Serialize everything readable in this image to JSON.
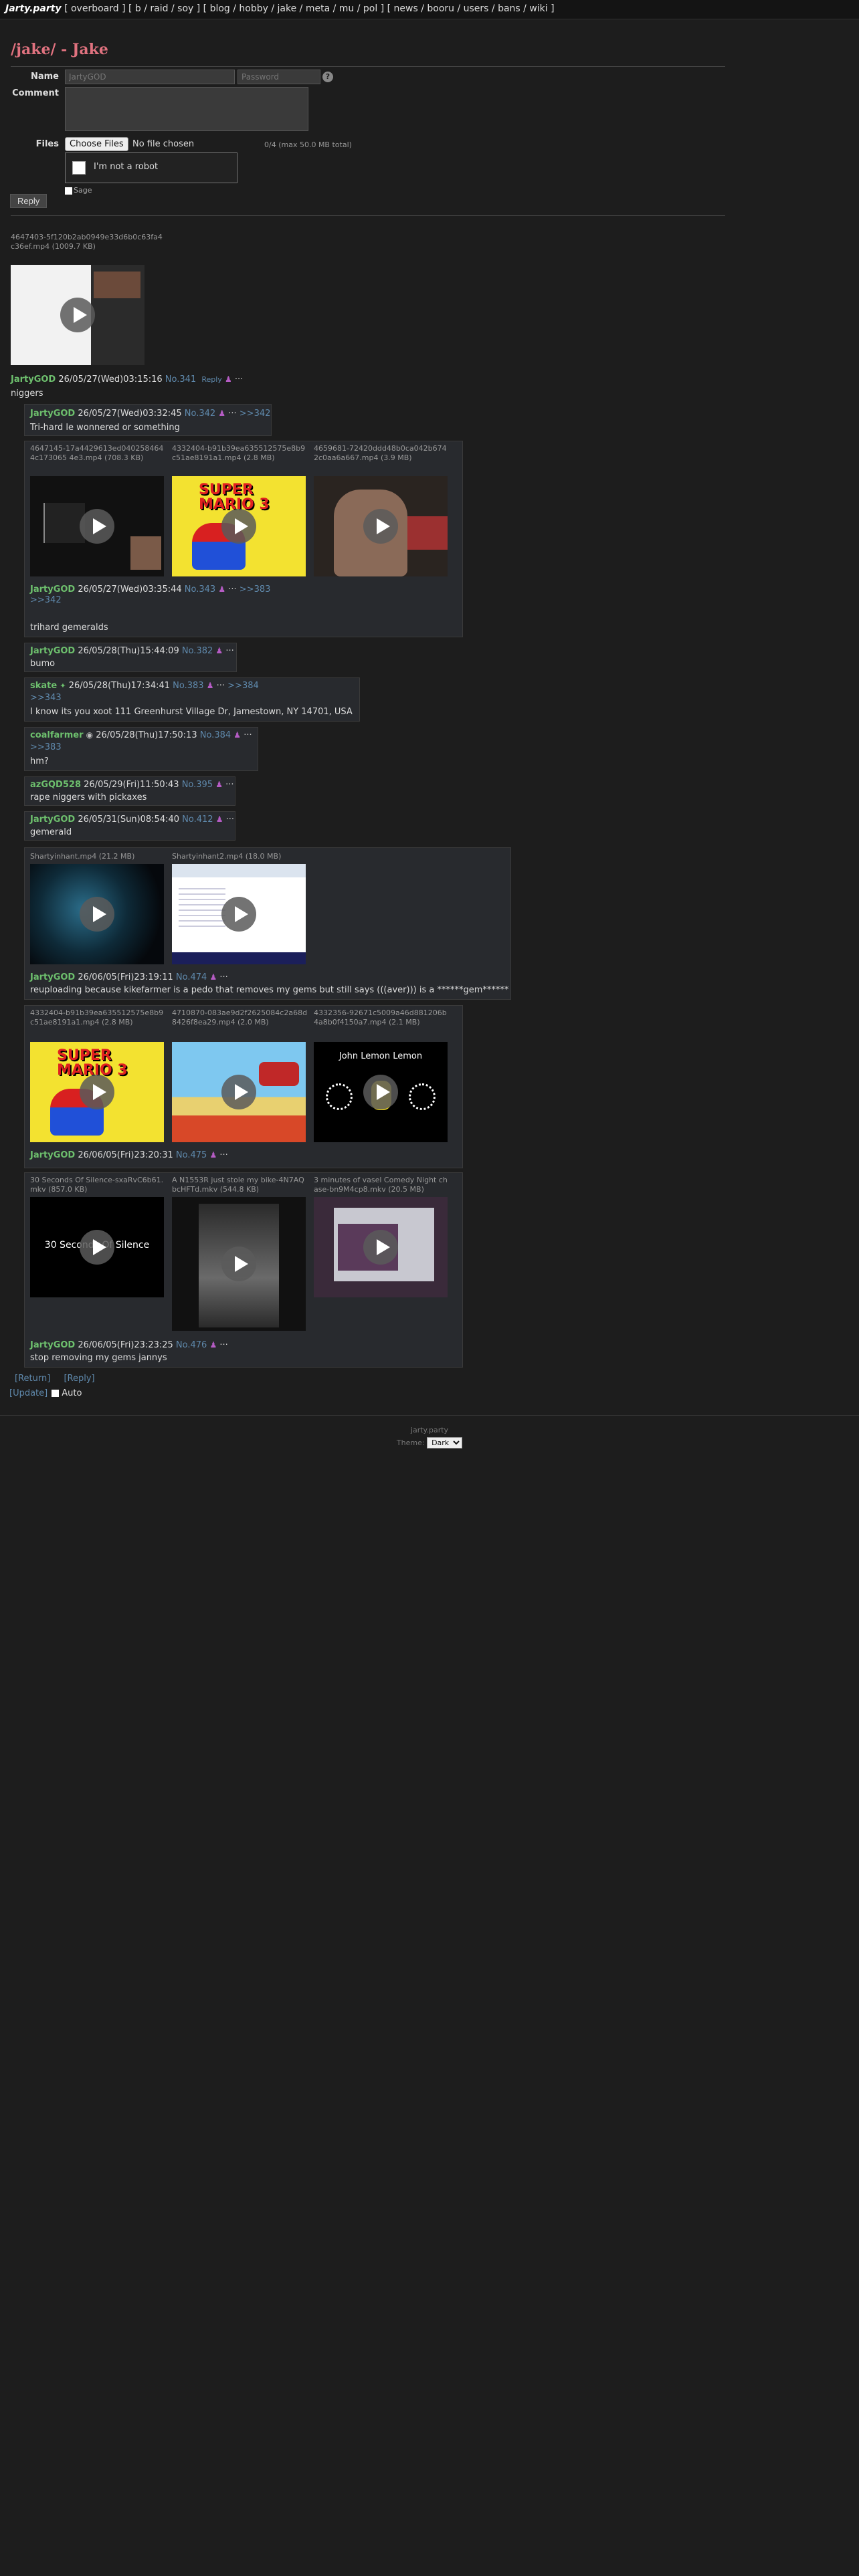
{
  "nav": {
    "logo": "Jarty.party",
    "groups": [
      "[ overboard ]",
      "[ b / raid / soy ]",
      "[ blog / hobby / jake / meta / mu / pol ]",
      "[ news / booru / users / bans / wiki ]"
    ]
  },
  "board": {
    "title": "/jake/ - Jake"
  },
  "form": {
    "name_label": "Name",
    "name_placeholder": "JartyGOD",
    "password_placeholder": "Password",
    "help": "?",
    "comment_label": "Comment",
    "files_label": "Files",
    "choose_files": "Choose Files",
    "no_file": "No file chosen",
    "file_limit": "0/4  (max 50.0 MB total)",
    "captcha": "I'm not a robot",
    "sage": "Sage",
    "submit": "Reply"
  },
  "op": {
    "fileinfo": "4647403-5f120b2ab0949e33d6b0c63fa4c36ef.mp4 (1009.7 KB)",
    "name": "JartyGOD",
    "date": "26/05/27(Wed)03:15:16",
    "no": "No.341",
    "reply_link": "Reply",
    "body": "niggers"
  },
  "replies": [
    {
      "name": "JartyGOD",
      "date": "26/05/27(Wed)03:32:45",
      "no": "No.342",
      "backlinks": ">>342",
      "body": "Tri-hard le wonnered or something"
    },
    {
      "files": [
        "4647145-17a4429613ed0402584644c173065 4e3.mp4 (708.3 KB)",
        "4332404-b91b39ea635512575e8b9c51ae8191a1.mp4 (2.8 MB)",
        "4659681-72420ddd48b0ca042b6742c0aa6a667.mp4 (3.9 MB)"
      ],
      "name": "JartyGOD",
      "date": "26/05/27(Wed)03:35:44",
      "no": "No.343",
      "backlinks": ">>383",
      "quote": ">>342",
      "body": "trihard gemeralds"
    },
    {
      "name": "JartyGOD",
      "date": "26/05/28(Thu)15:44:09",
      "no": "No.382",
      "body": "bumo"
    },
    {
      "name": "skate",
      "date": "26/05/28(Thu)17:34:41",
      "no": "No.383",
      "backlinks": ">>384",
      "quote": ">>343",
      "body": "I know its you xoot 111 Greenhurst Village Dr, Jamestown, NY 14701, USA"
    },
    {
      "name": "coalfarmer",
      "date": "26/05/28(Thu)17:50:13",
      "no": "No.384",
      "quote": ">>383",
      "body": "hm?"
    },
    {
      "name": "azGQD528",
      "date": "26/05/29(Fri)11:50:43",
      "no": "No.395",
      "body": "rape niggers with pickaxes"
    },
    {
      "name": "JartyGOD",
      "date": "26/05/31(Sun)08:54:40",
      "no": "No.412",
      "body": "gemerald"
    },
    {
      "files": [
        "Shartyinhant.mp4 (21.2 MB)",
        "Shartyinhant2.mp4 (18.0 MB)"
      ],
      "name": "JartyGOD",
      "date": "26/06/05(Fri)23:19:11",
      "no": "No.474",
      "body": "reuploading because kikefarmer is a pedo that removes my gems but still says (((aver))) is a ******gem******"
    },
    {
      "files": [
        "4332404-b91b39ea635512575e8b9c51ae8191a1.mp4 (2.8 MB)",
        "4710870-083ae9d2f2625084c2a68d8426f8ea29.mp4 (2.0 MB)",
        "4332356-92671c5009a46d881206b4a8b0f4150a7.mp4 (2.1 MB)"
      ],
      "name": "JartyGOD",
      "date": "26/06/05(Fri)23:20:31",
      "no": "No.475",
      "body": ""
    },
    {
      "files": [
        "30 Seconds Of Silence-sxaRvC6b61.mkv (857.0 KB)",
        "A N1553R just stole my bike-4N7AQbcHFTd.mkv (544.8 KB)",
        "3 minutes of vasel Comedy Night chase-bn9M4cp8.mkv (20.5 MB)"
      ],
      "name": "JartyGOD",
      "date": "26/06/05(Fri)23:23:25",
      "no": "No.476",
      "body": "stop removing my gems jannys"
    }
  ],
  "thread_links": {
    "return": "[Return]",
    "reply": "[Reply]",
    "update": "[Update]",
    "auto": "Auto"
  },
  "footer": {
    "site": "jarty.party",
    "theme_label": "Theme:",
    "theme_value": "Dark"
  },
  "thumb_text": {
    "mario": "SUPER MARIO 3",
    "silence": "30 Seconds Of Silence",
    "lennon": "John Lemon Lemon"
  },
  "icons": {
    "pin": "pin-icon",
    "menu": "dots-icon",
    "play": "play-icon"
  }
}
